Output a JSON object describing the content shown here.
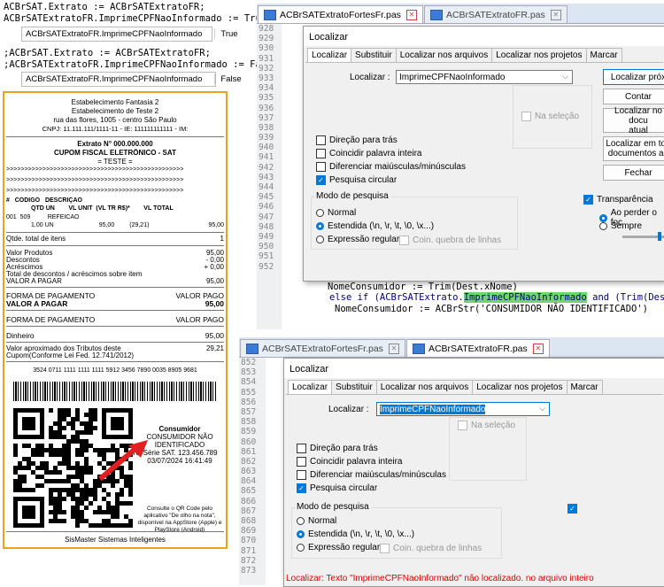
{
  "left_code": {
    "line1": "ACBrSAT.Extrato := ACBrSATExtratoFR;",
    "line2": "ACBrSATExtratoFR.ImprimeCPFNaoInformado := True;",
    "inspect1_label": "ACBrSATExtratoFR.ImprimeCPFNaoInformado",
    "inspect1_value": "True",
    "line3": ";ACBrSAT.Extrato := ACBrSATExtratoFR;",
    "line4": ";ACBrSATExtratoFR.ImprimeCPFNaoInformado := False;",
    "inspect2_label": "ACBrSATExtratoFR.ImprimeCPFNaoInformado",
    "inspect2_value": "False"
  },
  "receipt": {
    "h1": "Estabelecimento Fantasia 2",
    "h2": "Estabelecimento de Teste 2",
    "h3": "rua das flores, 1005 - centro São Paulo",
    "h4": "CNPJ: 11.111.111/1111-11 - IE: 111111111111 - IM:",
    "extrato": "Extrato N° 000.000.000",
    "cupom": "CUPOM FISCAL ELETRÔNICO - SAT",
    "teste": "= TESTE =",
    "arrows": ">>>>>>>>>>>>>>>>>>>>>>>>>>>>>>>>>>>>>>>>>>>>>>>>>",
    "col1": "#   CODIGO   DESCRIÇÃO",
    "col2": "QTD UN        VL UNIT  (VL TR R$)*        VL TOTAL",
    "item1": "001  509          REFEICAO",
    "item2": "1,00 UN",
    "item2_unit": "95,00",
    "item2_tr": "(29,21)",
    "item2_total": "95,00",
    "qtde_label": "Qtde. total de itens",
    "qtde_value": "1",
    "vp_label": "Valor Produtos",
    "vp_value": "95,00",
    "desc_label": "Descontos",
    "desc_value": "- 0,00",
    "acr_label": "Acréscimos",
    "acr_value": "+ 0,00",
    "totdesc_label": "Total de descontos / acréscimos sobre item",
    "pagar_label": "VALOR A PAGAR",
    "pagar_value": "95,00",
    "fp_label": "FORMA DE PAGAMENTO",
    "fp_value": "VALOR PAGO",
    "vap_label": "VALOR A PAGAR",
    "vap_value": "95,00",
    "fp2_label": "FORMA DE PAGAMENTO",
    "fp2_value": "VALOR PAGO",
    "din_label": "Dinheiro",
    "din_value": "95,00",
    "trib1": "Valor aproximado dos Tributos deste",
    "trib2": "Cupom(Conforme Lei Fed. 12.741/2012)",
    "trib_value": "29,21",
    "chave": "3524 0711 1111 1111 1111 5912 3456 7890 0035 8905 9681",
    "consumidor": "Consumidor",
    "consumidor2": "CONSUMIDOR NÃO",
    "consumidor3": "IDENTIFICADO",
    "serie": "N° Série SAT. 123.456.789",
    "data": "03/07/2024 16:41:49",
    "qr1": "Consulte o QR Code pelo",
    "qr2": "aplicativo \"De olho na nota\",",
    "qr3": "disponível na AppStore (Apple) e",
    "qr4": "PlayStore (Android)",
    "footer": "SisMaster Sistemas Inteligentes"
  },
  "top_editor": {
    "tab1": "ACBrSATExtratoFortesFr.pas",
    "tab2": "ACBrSATExtratoFR.pas",
    "lines": [
      "928",
      "929",
      "930",
      "931",
      "932",
      "933",
      "934",
      "935",
      "936",
      "937",
      "938",
      "939",
      "940",
      "941",
      "942",
      "943",
      "944",
      "945",
      "946",
      "947",
      "948",
      "949",
      "950",
      "951",
      "952"
    ],
    "code1": "NomeConsumidor := Trim(Dest.xNome)",
    "code2a": "else if (ACBrSATExtrato.",
    "code2b": "ImprimeCPFNaoInformado",
    "code2c": " and (Trim(Des",
    "code3": "NomeConsumidor := ACBrStr('CONSUMIDOR NÃO IDENTIFICADO')"
  },
  "top_dialog": {
    "title": "Localizar",
    "tabs": [
      "Localizar",
      "Substituir",
      "Localizar nos arquivos",
      "Localizar nos projetos",
      "Marcar"
    ],
    "find_label": "Localizar :",
    "find_value": "ImprimeCPFNaoInformado",
    "btn_next": "Localizar próx",
    "btn_count": "Contar",
    "btn_doc1": "Localizar no docu",
    "btn_doc2": "atual",
    "btn_all1": "Localizar em tod",
    "btn_all2": "documentos ab",
    "btn_close": "Fechar",
    "na_selecao": "Na seleção",
    "opt_back": "Direção para trás",
    "opt_word": "Coincidir palavra inteira",
    "opt_case": "Diferenciar maiúsculas/minúsculas",
    "opt_wrap": "Pesquisa circular",
    "mode_title": "Modo de pesquisa",
    "mode_normal": "Normal",
    "mode_ext": "Estendida  (\\n, \\r, \\t, \\0, \\x...)",
    "mode_regex": "Expressão regular",
    "coin": "Coin. quebra de linhas",
    "transp": "Transparência",
    "transp_focus": "Ao perder o foc",
    "transp_always": "Sempre"
  },
  "bottom_editor": {
    "tab1": "ACBrSATExtratoFortesFr.pas",
    "tab2": "ACBrSATExtratoFR.pas",
    "lines": [
      "852",
      "853",
      "854",
      "855",
      "856",
      "857",
      "858",
      "859",
      "860",
      "861",
      "862",
      "863",
      "864",
      "865",
      "866",
      "867",
      "868",
      "869",
      "870",
      "871",
      "872",
      "873"
    ]
  },
  "bottom_dialog": {
    "title": "Localizar",
    "tabs": [
      "Localizar",
      "Substituir",
      "Localizar nos arquivos",
      "Localizar nos projetos",
      "Marcar"
    ],
    "find_label": "Localizar :",
    "find_value": "ImprimeCPFNaoInformado",
    "na_selecao": "Na seleção",
    "opt_back": "Direção para trás",
    "opt_word": "Coincidir palavra inteira",
    "opt_case": "Diferenciar maiúsculas/minúsculas",
    "opt_wrap": "Pesquisa circular",
    "mode_title": "Modo de pesquisa",
    "mode_normal": "Normal",
    "mode_ext": "Estendida  (\\n, \\r, \\t, \\0, \\x...)",
    "mode_regex": "Expressão regular",
    "coin": "Coin. quebra de linhas",
    "status": "Localizar: Texto \"ImprimeCPFNaoInformado\" não localizado. no arquivo inteiro"
  },
  "colors": {
    "accent": "#0078d7",
    "receipt_border": "#e8a420",
    "highlight": "#6fd66f",
    "status": "#e00000"
  }
}
